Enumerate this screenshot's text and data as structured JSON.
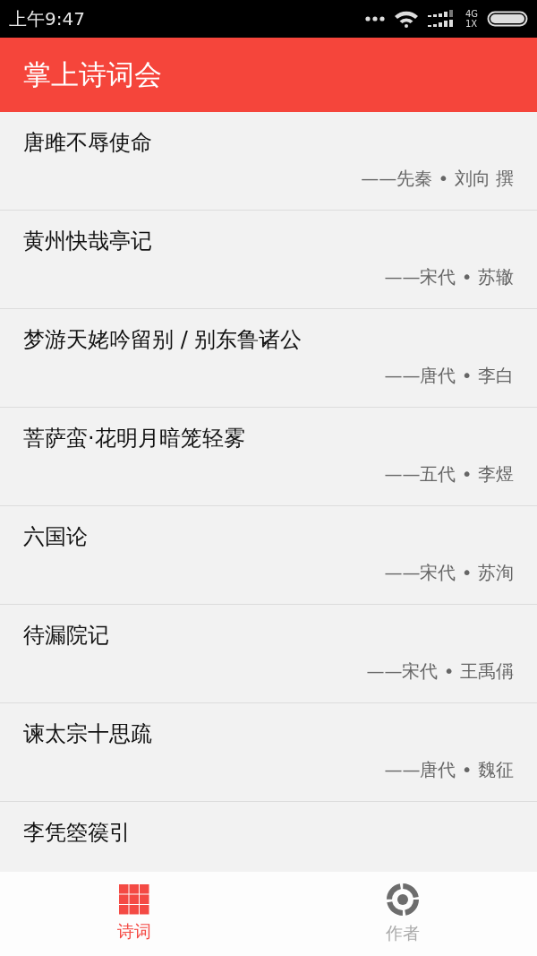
{
  "status_bar": {
    "time": "上午9:47",
    "network_top": "4G",
    "network_bottom": "1X"
  },
  "app_bar": {
    "title": "掌上诗词会"
  },
  "poems": [
    {
      "title": "唐雎不辱使命",
      "author": "——先秦 • 刘向 撰"
    },
    {
      "title": "黄州快哉亭记",
      "author": "——宋代 • 苏辙"
    },
    {
      "title": "梦游天姥吟留别 / 别东鲁诸公",
      "author": "——唐代 • 李白"
    },
    {
      "title": "菩萨蛮·花明月暗笼轻雾",
      "author": "——五代 • 李煜"
    },
    {
      "title": "六国论",
      "author": "——宋代 • 苏洵"
    },
    {
      "title": "待漏院记",
      "author": "——宋代 • 王禹偁"
    },
    {
      "title": "谏太宗十思疏",
      "author": "——唐代 • 魏征"
    },
    {
      "title": "李凭箜篌引"
    }
  ],
  "bottom_nav": [
    {
      "kind": "grid",
      "label": "诗词",
      "selected": true
    },
    {
      "kind": "target",
      "label": "作者",
      "selected": false
    }
  ]
}
